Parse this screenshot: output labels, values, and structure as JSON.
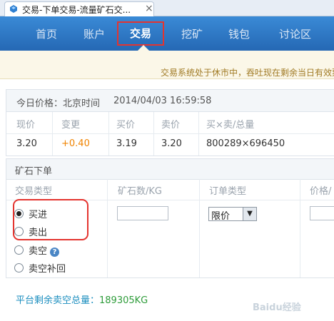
{
  "browser_tab": {
    "title": "交易-下单交易-流量矿石交...",
    "close": "×"
  },
  "nav": {
    "items": [
      "首页",
      "账户",
      "交易",
      "挖矿",
      "钱包",
      "讨论区"
    ],
    "active": "交易"
  },
  "notice": {
    "text": "交易系统处于休市中，吞吐现在剩余当日有效票"
  },
  "price": {
    "header_label": "今日价格：北京时间",
    "header_time": "2014/04/03 16:59:58",
    "columns": [
      "现价",
      "变更",
      "买价",
      "卖价",
      "买×卖/总量"
    ],
    "values": [
      "3.20",
      "+0.40",
      "3.19",
      "3.20",
      "800289×696450"
    ],
    "change_color": "#f08300"
  },
  "order": {
    "title": "矿石下单",
    "columns": [
      "交易类型",
      "矿石数/KG",
      "订单类型",
      "价格/"
    ],
    "trade_types": [
      {
        "label": "买进",
        "checked": true
      },
      {
        "label": "卖出",
        "checked": false
      },
      {
        "label": "卖空",
        "checked": false
      },
      {
        "label": "卖空补回",
        "checked": false
      }
    ],
    "order_type_selected": "限价",
    "qty_value": "",
    "price_value": ""
  },
  "footer": {
    "total_label": "平台剩余卖空总量：",
    "total_value": "189305KG"
  },
  "watermark": "Baidu经验",
  "colors": {
    "nav_bg": "#2e7cc8",
    "highlight_red": "#e4342f",
    "notice_bg": "#fbf7e8",
    "total_blue": "#1b8ebf",
    "total_green": "#2e9c3a"
  }
}
